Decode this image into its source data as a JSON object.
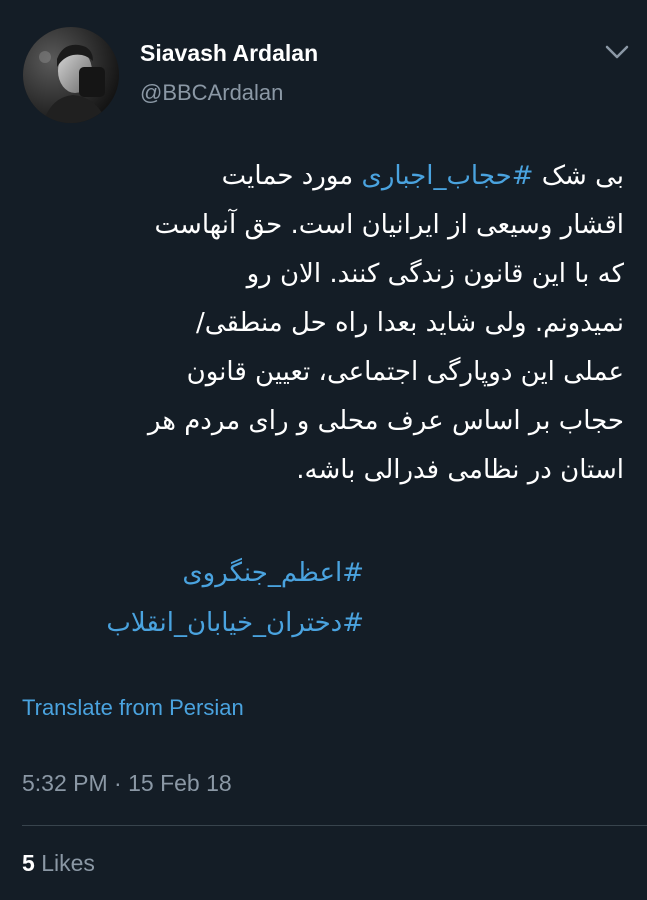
{
  "author": {
    "name": "Siavash Ardalan",
    "handle": "@BBCArdalan"
  },
  "icons": {
    "avatar": "avatar-photo",
    "menu": "chevron-down-icon"
  },
  "tweet": {
    "lines": [
      {
        "before": "بی شک ",
        "hashtag": "#حجاب_اجباری",
        "after": " مورد حمایت"
      },
      {
        "before": "اقشار وسیعی از ایرانیان است. حق آنهاست",
        "hashtag": "",
        "after": ""
      },
      {
        "before": "که با این قانون زندگی کنند. الان رو",
        "hashtag": "",
        "after": ""
      },
      {
        "before": "نمیدونم. ولی شاید بعدا راه حل منطقی/",
        "hashtag": "",
        "after": ""
      },
      {
        "before": "عملی این دوپارگی اجتماعی، تعیین قانون",
        "hashtag": "",
        "after": ""
      },
      {
        "before": "حجاب بر اساس عرف محلی و رای مردم هر",
        "hashtag": "",
        "after": ""
      },
      {
        "before": "استان در نظامی فدرالی باشه.",
        "hashtag": "",
        "after": ""
      }
    ],
    "hashtags": [
      "#اعظم_جنگروی",
      "#دختران_خیابان_انقلاب"
    ]
  },
  "translate_label": "Translate from Persian",
  "timestamp": "5:32 PM · 15 Feb 18",
  "likes": {
    "count": "5",
    "label": "Likes"
  },
  "colors": {
    "background": "#141d26",
    "link": "#4aa3df",
    "secondary": "#8b98a5",
    "text": "#ffffff"
  }
}
